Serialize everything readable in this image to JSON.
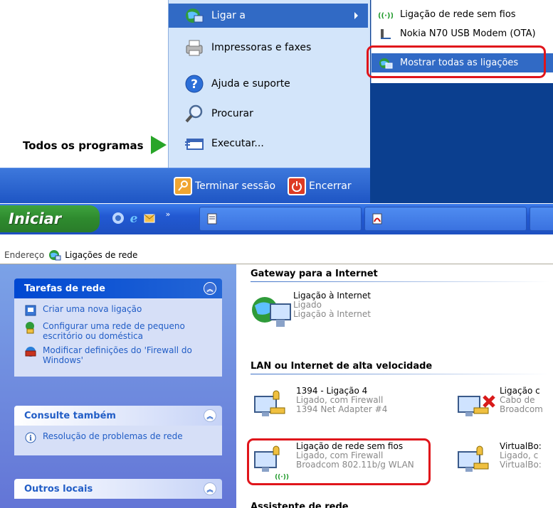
{
  "start_menu": {
    "right_items": [
      {
        "label": "Ligar a",
        "icon": "network-globe-icon",
        "has_submenu": true,
        "highlighted": true
      },
      {
        "label": "Impressoras e faxes",
        "icon": "printer-icon"
      },
      {
        "label": "Ajuda e suporte",
        "icon": "help-icon"
      },
      {
        "label": "Procurar",
        "icon": "search-icon"
      },
      {
        "label": "Executar...",
        "icon": "run-icon"
      }
    ],
    "all_programs": "Todos os programas",
    "logoff": "Terminar sessão",
    "shutdown": "Encerrar",
    "submenu": [
      {
        "label": "Ligação de rede sem fios",
        "icon": "wireless-icon"
      },
      {
        "label": "Nokia N70 USB Modem (OTA)",
        "icon": "modem-icon"
      },
      {
        "label": "Mostrar todas as ligações",
        "icon": "network-globe-icon",
        "highlighted": true
      }
    ]
  },
  "taskbar": {
    "start_label": "Iniciar"
  },
  "address_bar": {
    "label": "Endereço",
    "value": "Ligações de rede"
  },
  "task_pane": {
    "network_tasks": {
      "title": "Tarefas de rede",
      "links": [
        "Criar uma nova ligação",
        "Configurar uma rede de pequeno escritório ou doméstica",
        "Modificar definições do 'Firewall do Windows'"
      ]
    },
    "see_also": {
      "title": "Consulte também",
      "links": [
        "Resolução de problemas de rede"
      ]
    },
    "other_places": {
      "title": "Outros locais"
    }
  },
  "content": {
    "gateway_header": "Gateway para a Internet",
    "gateway_item": {
      "name": "Ligação à Internet",
      "status": "Ligado",
      "device": "Ligação à Internet"
    },
    "lan_header": "LAN ou Internet de alta velocidade",
    "lan_items": [
      {
        "name": "1394 - Ligação 4",
        "status": "Ligado, com Firewall",
        "device": "1394 Net Adapter #4"
      },
      {
        "name": "Ligação c",
        "status": "Cabo de",
        "device": "Broadcom"
      },
      {
        "name": "Ligação de rede sem fios",
        "status": "Ligado, com Firewall",
        "device": "Broadcom 802.11b/g WLAN"
      },
      {
        "name": "VirtualBo:",
        "status": "Ligado, c",
        "device": "VirtualBo:"
      }
    ],
    "partial_header": "Assistente de rede"
  },
  "colors": {
    "highlight": "#316ac5",
    "annotation_red": "#e0151b",
    "xp_blue": "#215dc6",
    "start_green": "#2e8a2e"
  }
}
